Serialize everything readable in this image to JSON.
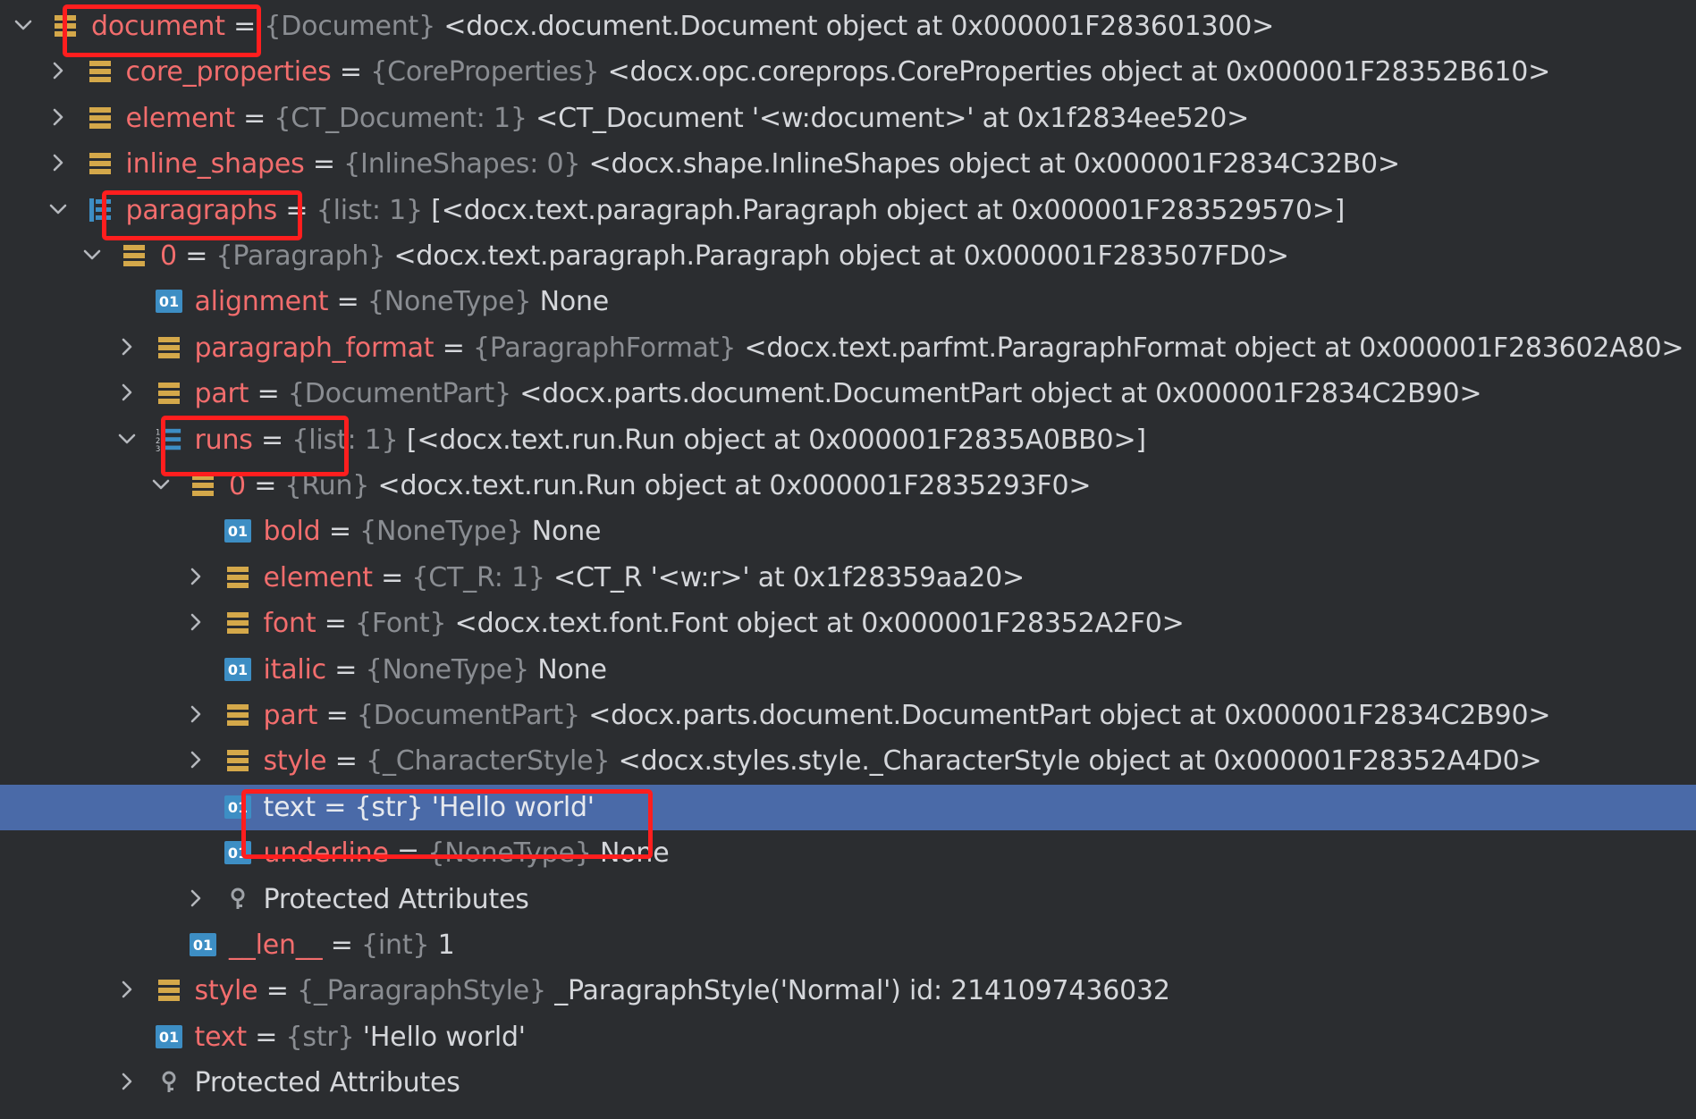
{
  "colors": {
    "background": "#2b2d30",
    "selected_row": "#4a6aa8",
    "name": "#f26d6d",
    "type": "#8a8d92",
    "value": "#d5d7db",
    "object_icon": "#d4a84a",
    "primitive_icon": "#3d8ec4",
    "highlight_box": "#ff1e1e"
  },
  "tree": {
    "rows": [
      {
        "level": 0,
        "arrow": "expanded",
        "icon": "object-icon",
        "name": "document",
        "type": "{Document}",
        "value": "<docx.document.Document object at 0x000001F283601300>"
      },
      {
        "level": 1,
        "arrow": "collapsed",
        "icon": "object-icon",
        "name": "core_properties",
        "type": "{CoreProperties}",
        "value": "<docx.opc.coreprops.CoreProperties object at 0x000001F28352B610>"
      },
      {
        "level": 1,
        "arrow": "collapsed",
        "icon": "object-icon",
        "name": "element",
        "type": "{CT_Document: 1}",
        "value": "<CT_Document '<w:document>' at 0x1f2834ee520>"
      },
      {
        "level": 1,
        "arrow": "collapsed",
        "icon": "object-icon",
        "name": "inline_shapes",
        "type": "{InlineShapes: 0}",
        "value": "<docx.shape.InlineShapes object at 0x000001F2834C32B0>"
      },
      {
        "level": 1,
        "arrow": "expanded",
        "icon": "list-icon",
        "name": "paragraphs",
        "type": "{list: 1}",
        "value": "[<docx.text.paragraph.Paragraph object at 0x000001F283529570>]"
      },
      {
        "level": 2,
        "arrow": "expanded",
        "icon": "object-icon",
        "name": "0",
        "type": "{Paragraph}",
        "value": "<docx.text.paragraph.Paragraph object at 0x000001F283507FD0>"
      },
      {
        "level": 3,
        "arrow": "none",
        "icon": "primitive-icon",
        "name": "alignment",
        "type": "{NoneType}",
        "value": "None"
      },
      {
        "level": 3,
        "arrow": "collapsed",
        "icon": "object-icon",
        "name": "paragraph_format",
        "type": "{ParagraphFormat}",
        "value": "<docx.text.parfmt.ParagraphFormat object at 0x000001F283602A80>"
      },
      {
        "level": 3,
        "arrow": "collapsed",
        "icon": "object-icon",
        "name": "part",
        "type": "{DocumentPart}",
        "value": "<docx.parts.document.DocumentPart object at 0x000001F2834C2B90>"
      },
      {
        "level": 3,
        "arrow": "expanded",
        "icon": "ordered-list-icon",
        "name": "runs",
        "type": "{list: 1}",
        "value": "[<docx.text.run.Run object at 0x000001F2835A0BB0>]"
      },
      {
        "level": 4,
        "arrow": "expanded",
        "icon": "object-icon",
        "name": "0",
        "type": "{Run}",
        "value": "<docx.text.run.Run object at 0x000001F2835293F0>"
      },
      {
        "level": 5,
        "arrow": "none",
        "icon": "primitive-icon",
        "name": "bold",
        "type": "{NoneType}",
        "value": "None"
      },
      {
        "level": 5,
        "arrow": "collapsed",
        "icon": "object-icon",
        "name": "element",
        "type": "{CT_R: 1}",
        "value": "<CT_R '<w:r>' at 0x1f28359aa20>"
      },
      {
        "level": 5,
        "arrow": "collapsed",
        "icon": "object-icon",
        "name": "font",
        "type": "{Font}",
        "value": "<docx.text.font.Font object at 0x000001F28352A2F0>"
      },
      {
        "level": 5,
        "arrow": "none",
        "icon": "primitive-icon",
        "name": "italic",
        "type": "{NoneType}",
        "value": "None"
      },
      {
        "level": 5,
        "arrow": "collapsed",
        "icon": "object-icon",
        "name": "part",
        "type": "{DocumentPart}",
        "value": "<docx.parts.document.DocumentPart object at 0x000001F2834C2B90>"
      },
      {
        "level": 5,
        "arrow": "collapsed",
        "icon": "object-icon",
        "name": "style",
        "type": "{_CharacterStyle}",
        "value": "<docx.styles.style._CharacterStyle object at 0x000001F28352A4D0>"
      },
      {
        "level": 5,
        "arrow": "none",
        "icon": "primitive-icon",
        "name": "text",
        "type": "{str}",
        "value": "'Hello world'",
        "selected": true
      },
      {
        "level": 5,
        "arrow": "none",
        "icon": "primitive-icon",
        "name": "underline",
        "type": "{NoneType}",
        "value": "None"
      },
      {
        "level": 5,
        "arrow": "collapsed",
        "icon": "key-icon",
        "label": "Protected Attributes"
      },
      {
        "level": 4,
        "arrow": "none",
        "icon": "primitive-icon",
        "name": "__len__",
        "type": "{int}",
        "value": "1"
      },
      {
        "level": 3,
        "arrow": "collapsed",
        "icon": "object-icon",
        "name": "style",
        "type": "{_ParagraphStyle}",
        "value": "_ParagraphStyle('Normal') id: 2141097436032"
      },
      {
        "level": 3,
        "arrow": "none",
        "icon": "primitive-icon",
        "name": "text",
        "type": "{str}",
        "value": "'Hello world'"
      },
      {
        "level": 3,
        "arrow": "collapsed",
        "icon": "key-icon",
        "label": "Protected Attributes"
      }
    ]
  }
}
